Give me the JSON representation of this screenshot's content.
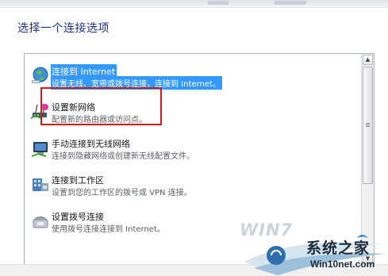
{
  "heading": "选择一个连接选项",
  "options": [
    {
      "title": "连接到 Internet",
      "desc": "设置无线、宽带或拨号连接，连接到 Internet。",
      "icon": "globe-network-icon",
      "selected": true
    },
    {
      "title": "设置新网络",
      "desc": "配置新的路由器或访问点。",
      "icon": "router-setup-icon",
      "selected": false
    },
    {
      "title": "手动连接到无线网络",
      "desc": "连接到隐藏网络或创建新无线配置文件。",
      "icon": "wireless-network-icon",
      "selected": false
    },
    {
      "title": "连接到工作区",
      "desc": "设置到您的工作区的拨号或 VPN 连接。",
      "icon": "workplace-vpn-icon",
      "selected": false
    },
    {
      "title": "设置拨号连接",
      "desc": "使用拨号连接连接到 Internet。",
      "icon": "dialup-phone-icon",
      "selected": false
    }
  ],
  "watermark": {
    "brand": "WIN7",
    "name": "系统之家",
    "site": "Win10net.com"
  },
  "colors": {
    "heading": "#1e3287",
    "selection": "#3399ff",
    "highlight_box": "#d21a1a"
  }
}
